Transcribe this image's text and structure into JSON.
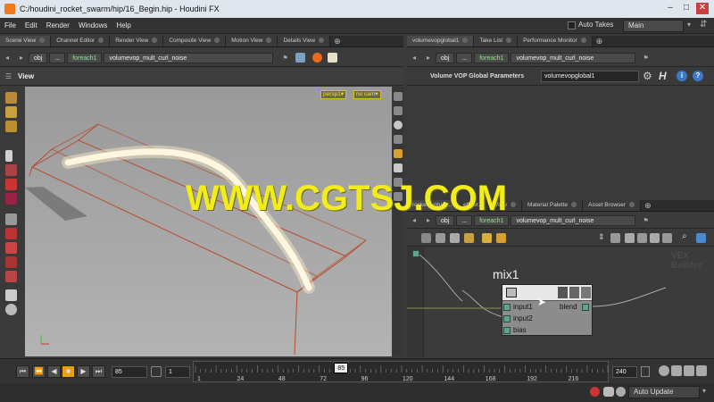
{
  "window": {
    "title": "C:/houdini_rocket_swarm/hip/16_Begin.hip - Houdini FX",
    "min": "–",
    "max": "□",
    "close": "✕"
  },
  "menu": [
    "File",
    "Edit",
    "Render",
    "Windows",
    "Help"
  ],
  "auto_takes_label": "Auto Takes",
  "desktop_select": "Main",
  "left_tabs": [
    "Scene View",
    "Channel Editor",
    "Render View",
    "Composite View",
    "Motion View",
    "Details View"
  ],
  "path_left": {
    "obj": "obj",
    "dots": "...",
    "foreach": "foreach1",
    "vop": "volumevop_mult_curl_noise"
  },
  "viewport": {
    "label": "View",
    "persp": "persp1▾",
    "cam": "no cam▾",
    "watermark": "WWW.CGTSJ.COM"
  },
  "right_top_tabs": [
    "volumevopglobal1",
    "Take List",
    "Performance Monitor"
  ],
  "path_right_top": {
    "obj": "obj",
    "dots": "...",
    "foreach": "foreach1",
    "vop": "volumevop_mult_curl_noise"
  },
  "params": {
    "title": "Volume VOP Global Parameters",
    "value": "volumevopglobal1"
  },
  "right_bottom_tabs": [
    "rocket_volum...",
    "eff(for...",
    "View",
    "Material Palette",
    "Asset Browser"
  ],
  "path_right_bottom": {
    "obj": "obj",
    "dots": "...",
    "foreach": "foreach1",
    "vop": "volumevop_mult_curl_noise"
  },
  "network": {
    "node_name": "mix1",
    "inputs": [
      "input1",
      "input2",
      "bias"
    ],
    "output": "blend",
    "bg_label": "VEX Builder"
  },
  "timeline": {
    "frame": "85",
    "start": "1",
    "end": "240",
    "ticks": [
      "1",
      "24",
      "48",
      "72",
      "96",
      "120",
      "144",
      "168",
      "192",
      "216"
    ],
    "current_marker": "85",
    "current_fraction": 0.3515,
    "tick_fractions": [
      0,
      0.0962,
      0.1967,
      0.2971,
      0.3975,
      0.4979,
      0.5983,
      0.6987,
      0.7992,
      0.8996
    ]
  },
  "status": {
    "auto_update": "Auto Update"
  },
  "colors": {
    "accent": "#f0c020",
    "port": "#5fa58a",
    "watermark": "#f2ec1a"
  }
}
